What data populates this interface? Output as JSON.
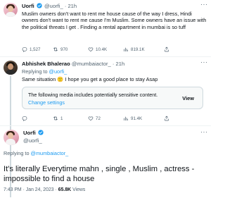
{
  "tweet1": {
    "display_name": "Uorfi",
    "handle": "@uorfi_",
    "time": "21h",
    "text": "Muslim owners don't want to rent me house cause of the way I dress, Hindi owners don't want to rent me cause I'm Muslim. Some owners have an issue with the political threats I get . Finding a rental apartment in mumbai is so tuff",
    "replies": "1,527",
    "retweets": "970",
    "likes": "10.4K",
    "views": "819.1K"
  },
  "tweet2": {
    "display_name": "Abhishek Bhalerao",
    "handle": "@mumbaiactor_",
    "time": "21h",
    "replying_label": "Replying to",
    "replying_to": "@uorfi_",
    "text": "Same situation 🙁 I hope you get a good place to stay Asap",
    "media_warning": "The following media includes potentially sensitive content.",
    "media_settings_link": "Change settings",
    "media_view_button": "View",
    "replies": "",
    "retweets": "1",
    "likes": "72",
    "views": "91.4K"
  },
  "tweet3": {
    "display_name": "Uorfi",
    "handle": "@uorfi_",
    "replying_label": "Replying to",
    "replying_to": "@mumbaiactor_",
    "text": "It's literally Everytime mahn , single , Muslim , actress - impossible to find a house",
    "timestamp": "7:43 PM · Jan 24, 2023 ·",
    "views_count": "65.8K",
    "views_label": "Views"
  },
  "colors": {
    "accent": "#1d9bf0",
    "text": "#0f1419",
    "muted": "#536471",
    "border": "#cfd9de"
  },
  "icons": [
    "verified-badge-icon",
    "more-options-icon",
    "reply-icon",
    "retweet-icon",
    "like-icon",
    "views-icon",
    "share-icon"
  ]
}
